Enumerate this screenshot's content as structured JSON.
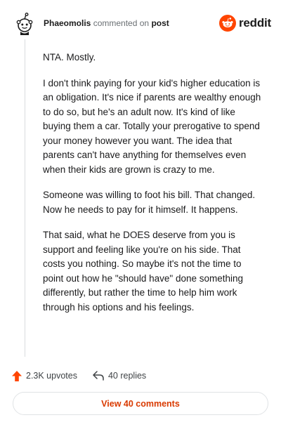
{
  "header": {
    "username": "Phaeomolis",
    "action_text": "commented on",
    "target": "post",
    "brand": "reddit"
  },
  "comment": {
    "paragraphs": [
      "NTA. Mostly.",
      "I don't think paying for your kid's higher education is an obligation. It's nice if parents are wealthy enough to do so, but he's an adult now. It's kind of like buying them a car. Totally your prerogative to spend your money however you want. The idea that parents can't have anything for themselves even when their kids are grown is crazy to me.",
      "Someone was willing to foot his bill. That changed. Now he needs to pay for it himself. It happens.",
      "That said, what he DOES deserve from you is support and feeling like you're on his side. That costs you nothing. So maybe it's not the time to point out how he \"should have\" done something differently, but rather the time to help him work through his options and his feelings."
    ]
  },
  "actions": {
    "upvotes": "2.3K upvotes",
    "replies": "40 replies"
  },
  "footer": {
    "view_button": "View 40 comments"
  },
  "colors": {
    "brand_orange": "#ff4500",
    "link_orange": "#d93a00",
    "thread_line": "#d9dcde"
  },
  "icons": {
    "avatar": "snoo-avatar-icon",
    "brand": "reddit-logo-icon",
    "upvote": "upvote-arrow-icon",
    "reply": "reply-arrow-icon"
  }
}
